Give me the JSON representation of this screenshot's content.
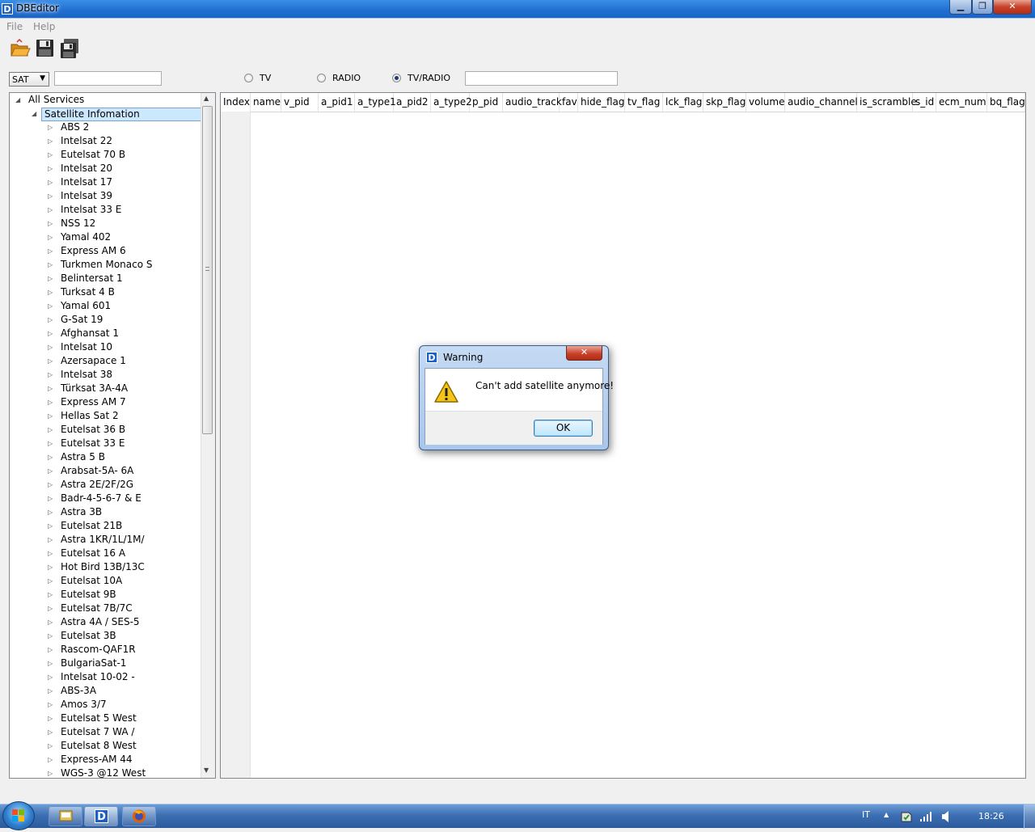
{
  "window": {
    "title": "DBEditor",
    "app_icon": "D",
    "minimize_glyph": "▁",
    "maximize_glyph": "❐",
    "close_glyph": "✕"
  },
  "menu": {
    "items": [
      "File",
      "Help"
    ]
  },
  "toolbar": {
    "buttons": [
      {
        "icon": "open-folder-icon"
      },
      {
        "icon": "save-icon"
      },
      {
        "icon": "save-as-icon"
      }
    ]
  },
  "filters": {
    "combo_value": "SAT",
    "combo_arrow": "▼",
    "radios": [
      {
        "label": "TV",
        "checked": false
      },
      {
        "label": "RADIO",
        "checked": false
      },
      {
        "label": "TV/RADIO",
        "checked": true
      }
    ]
  },
  "tree": {
    "root": "All Services",
    "group": "Satellite Infomation",
    "items": [
      "ABS 2",
      "Intelsat 22",
      "Eutelsat 70 B",
      "Intelsat 20",
      "Intelsat 17",
      "Intelsat 39",
      "Intelsat 33 E",
      "NSS 12",
      "Yamal 402",
      "Express AM 6",
      "Turkmen Monaco S",
      "Belintersat 1",
      "Turksat 4 B",
      "Yamal 601",
      "G-Sat 19",
      "Afghansat 1",
      "Intelsat 10",
      "Azersapace 1",
      "Intelsat 38",
      "Türksat 3A-4A",
      "Express AM 7",
      "Hellas Sat 2",
      "Eutelsat 36 B",
      "Eutelsat 33 E",
      "Astra 5 B",
      "Arabsat-5A- 6A",
      "Astra 2E/2F/2G",
      "Badr-4-5-6-7 & E",
      "Astra 3B",
      "Eutelsat 21B",
      "Astra 1KR/1L/1M/",
      "Eutelsat 16 A",
      "Hot Bird 13B/13C",
      "Eutelsat 10A",
      "Eutelsat 9B",
      "Eutelsat 7B/7C",
      "Astra 4A / SES-5",
      "Eutelsat 3B",
      "Rascom-QAF1R",
      "BulgariaSat-1",
      "Intelsat 10-02 -",
      "ABS-3A",
      "Amos 3/7",
      "Eutelsat 5 West",
      "Eutelsat 7 WA /",
      "Eutelsat 8 West",
      "Express-AM 44",
      "WGS-3 @12 West"
    ],
    "scroll_up": "▲",
    "scroll_down": "▼"
  },
  "table": {
    "columns": [
      "Index",
      "name",
      "v_pid",
      "a_pid1",
      "a_type1",
      "a_pid2",
      "a_type2",
      "p_pid",
      "audio_track",
      "fav",
      "hide_flag",
      "tv_flag",
      "lck_flag",
      "skp_flag",
      "volume",
      "audio_channel",
      "is_scramble",
      "s_id",
      "ecm_num",
      "bq_flag"
    ]
  },
  "dialog": {
    "title": "Warning",
    "icon": "warning-icon",
    "message": "Can't add satellite anymore!",
    "ok_label": "OK",
    "close_glyph": "✕"
  },
  "taskbar": {
    "language": "IT",
    "time": "18:26",
    "tray_arrow": "▲"
  },
  "colors": {
    "accent": "#1f6fd0",
    "selection": "#cce8ff",
    "selection_border": "#7da2ce"
  }
}
